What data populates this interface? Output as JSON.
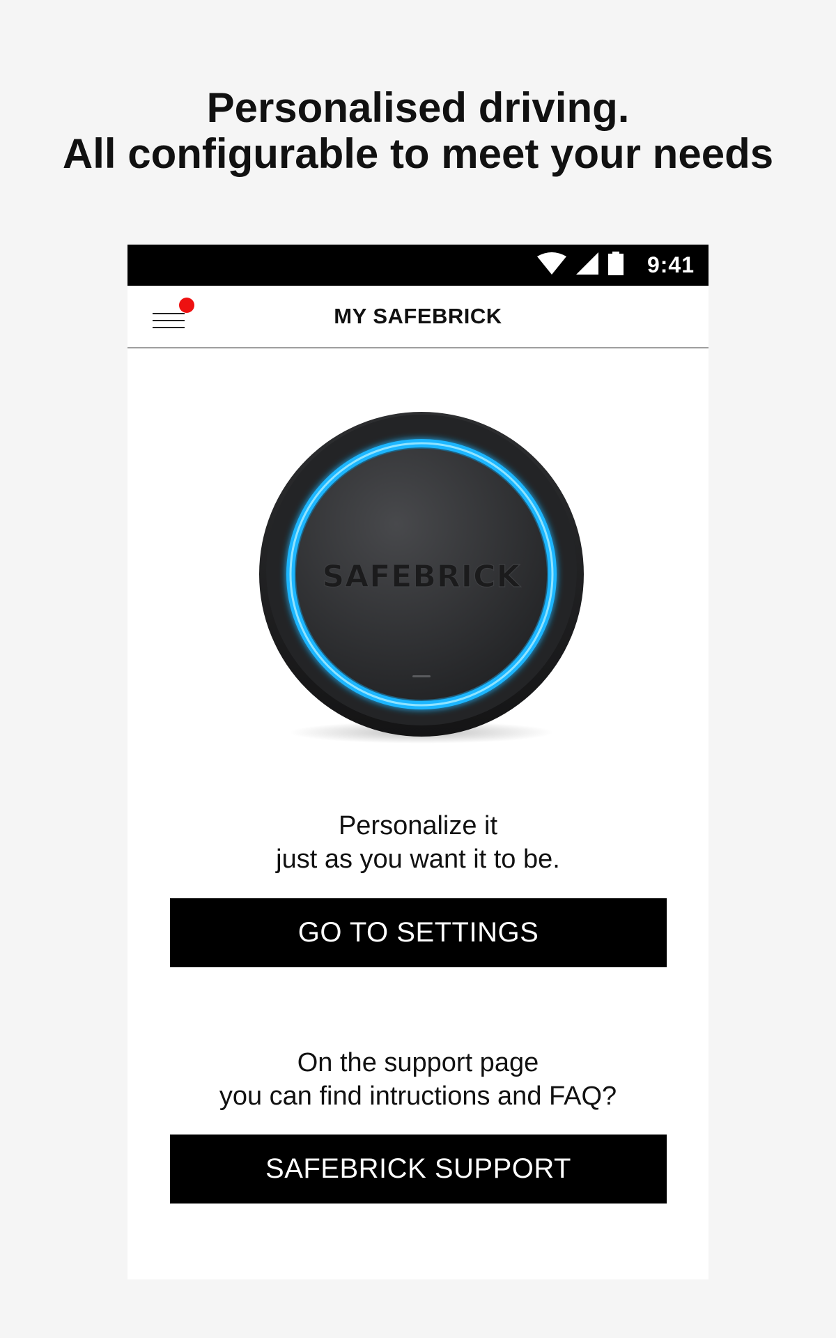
{
  "promo": {
    "headline_line1": "Personalised driving.",
    "headline_line2": "All configurable to meet your needs"
  },
  "status_bar": {
    "time": "9:41",
    "icons": [
      "wifi-icon",
      "cellular-signal-icon",
      "battery-icon"
    ]
  },
  "app_bar": {
    "title": "MY SAFEBRICK",
    "menu_icon": "hamburger-menu-icon",
    "notification_dot_color": "#ee1111"
  },
  "device": {
    "brand_text": "SAFEBRICK",
    "ring_color": "#1fb6ff"
  },
  "settings_section": {
    "line1": "Personalize it",
    "line2": "just as you want it to be.",
    "button_label": "GO TO SETTINGS"
  },
  "support_section": {
    "line1": "On the support page",
    "line2": "you can find intructions and FAQ?",
    "button_label": "SAFEBRICK SUPPORT"
  }
}
